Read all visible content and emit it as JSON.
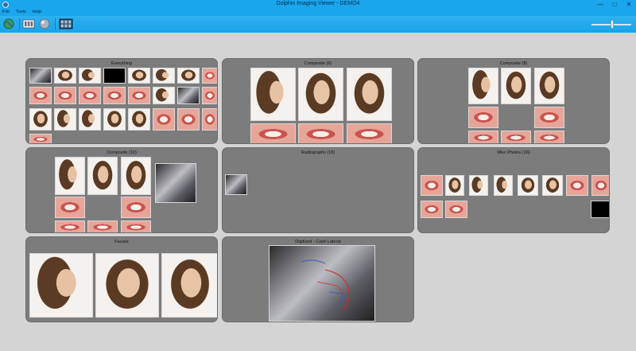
{
  "window": {
    "title": "Dolphin Imaging Viewer - DEMO4",
    "controls": [
      "—",
      "□",
      "✕"
    ]
  },
  "menu": [
    {
      "label": "File"
    },
    {
      "label": "Tools"
    },
    {
      "label": "Help"
    }
  ],
  "toolbar": {
    "buttons": [
      {
        "name": "globe-icon"
      },
      {
        "name": "film-strip-icon"
      },
      {
        "name": "sphere-icon"
      },
      {
        "name": "layout-grid-icon"
      }
    ],
    "zoom_slider": {
      "value": 0.5
    }
  },
  "panels": [
    {
      "id": "everything",
      "title": "Everything"
    },
    {
      "id": "composite-6",
      "title": "Composite (6)"
    },
    {
      "id": "composite-8",
      "title": "Composite (8)"
    },
    {
      "id": "composite-10",
      "title": "Composite (10)"
    },
    {
      "id": "radiographs",
      "title": "Radiographs (16)"
    },
    {
      "id": "misc-photos",
      "title": "Misc Photos (16)"
    },
    {
      "id": "facials",
      "title": "Facials"
    },
    {
      "id": "digitized",
      "title": "Digitized - Ceph Lateral"
    }
  ]
}
